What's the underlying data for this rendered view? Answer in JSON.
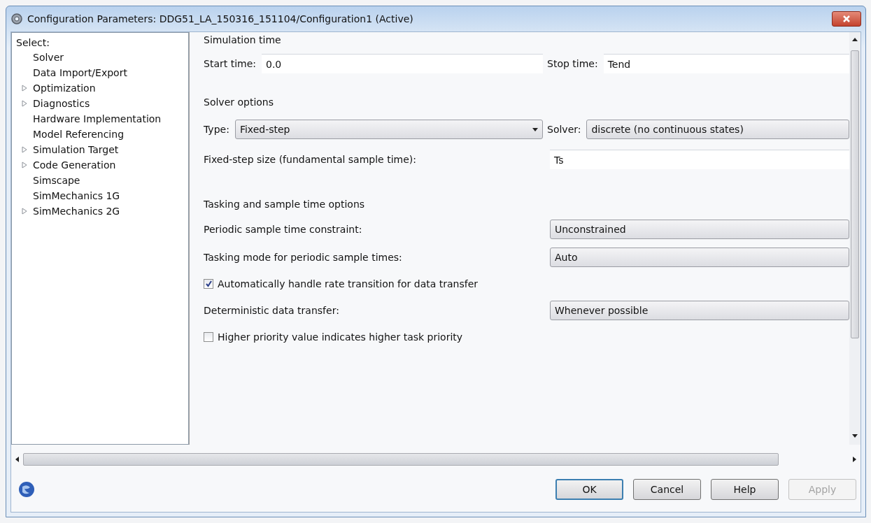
{
  "window": {
    "title": "Configuration Parameters: DDG51_LA_150316_151104/Configuration1 (Active)"
  },
  "sidebar": {
    "label": "Select:",
    "items": [
      {
        "label": "Solver",
        "kind": "leaf"
      },
      {
        "label": "Data Import/Export",
        "kind": "leaf"
      },
      {
        "label": "Optimization",
        "kind": "branch"
      },
      {
        "label": "Diagnostics",
        "kind": "branch"
      },
      {
        "label": "Hardware Implementation",
        "kind": "leaf"
      },
      {
        "label": "Model Referencing",
        "kind": "leaf"
      },
      {
        "label": "Simulation Target",
        "kind": "branch"
      },
      {
        "label": "Code Generation",
        "kind": "branch"
      },
      {
        "label": "Simscape",
        "kind": "leaf"
      },
      {
        "label": "SimMechanics 1G",
        "kind": "leaf"
      },
      {
        "label": "SimMechanics 2G",
        "kind": "branch"
      }
    ]
  },
  "panel": {
    "rows": [
      {
        "kind": "heading",
        "text": "Simulation time"
      },
      {
        "kind": "pair",
        "fields": [
          {
            "label": "Start time:",
            "kind": "text",
            "value": "0.0"
          },
          {
            "label": "Stop time:",
            "kind": "text",
            "value": "Tend"
          }
        ]
      },
      {
        "kind": "heading",
        "text": "Solver options"
      },
      {
        "kind": "pair",
        "fields": [
          {
            "label": "Type:",
            "kind": "dropdown",
            "value": "Fixed-step"
          },
          {
            "label": "Solver:",
            "kind": "list",
            "value": "discrete (no continuous states)"
          }
        ]
      },
      {
        "kind": "setting",
        "label": "Fixed-step size (fundamental sample time):",
        "field": {
          "kind": "text",
          "value": "Ts"
        }
      },
      {
        "kind": "heading",
        "text": "Tasking and sample time options"
      },
      {
        "kind": "setting",
        "label": "Periodic sample time constraint:",
        "field": {
          "kind": "list",
          "value": "Unconstrained"
        }
      },
      {
        "kind": "setting",
        "label": "Tasking mode for periodic sample times:",
        "field": {
          "kind": "list",
          "value": "Auto"
        }
      },
      {
        "kind": "checkbox",
        "label": "Automatically handle rate transition for data transfer",
        "checked": true
      },
      {
        "kind": "setting",
        "label": "Deterministic data transfer:",
        "field": {
          "kind": "list",
          "value": "Whenever possible"
        }
      },
      {
        "kind": "checkbox",
        "label": "Higher priority value indicates higher task priority",
        "checked": false
      }
    ]
  },
  "buttons": [
    {
      "label": "OK",
      "default": true,
      "disabled": false
    },
    {
      "label": "Cancel",
      "default": false,
      "disabled": false
    },
    {
      "label": "Help",
      "default": false,
      "disabled": false
    },
    {
      "label": "Apply",
      "default": false,
      "disabled": true
    }
  ]
}
